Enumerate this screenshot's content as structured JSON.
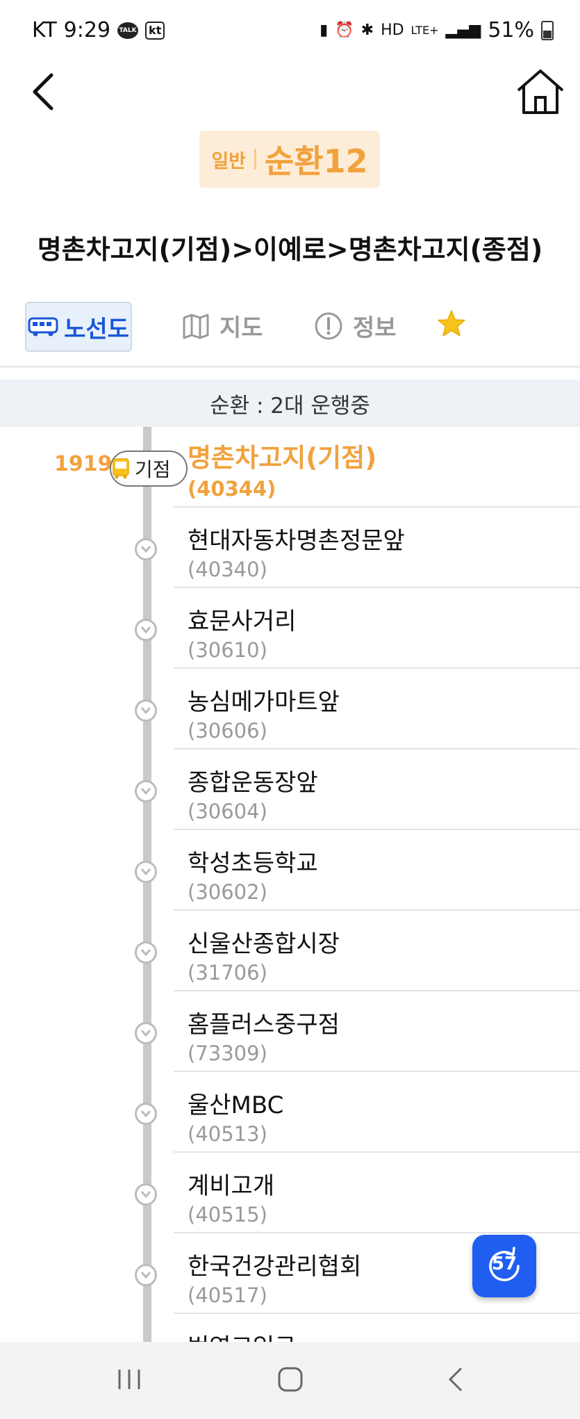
{
  "status_bar": {
    "carrier": "KT",
    "time": "9:29",
    "talk": "TALK",
    "kt": "kt",
    "network": "LTE+",
    "battery": "51%"
  },
  "route": {
    "type": "일반",
    "number": "순환12",
    "path": "명촌차고지(기점)>이예로>명촌차고지(종점)"
  },
  "tabs": [
    {
      "label": "노선도",
      "icon": "bus-icon"
    },
    {
      "label": "지도",
      "icon": "map-icon"
    },
    {
      "label": "정보",
      "icon": "info-icon"
    },
    {
      "label": "",
      "icon": "star-icon"
    }
  ],
  "operation_status": "순환 : 2대 운행중",
  "bus_position": {
    "vehicle": "1919",
    "label": "기점"
  },
  "stops": [
    {
      "name": "명촌차고지(기점)",
      "id": "(40344)"
    },
    {
      "name": "현대자동차명촌정문앞",
      "id": "(40340)"
    },
    {
      "name": "효문사거리",
      "id": "(30610)"
    },
    {
      "name": "농심메가마트앞",
      "id": "(30606)"
    },
    {
      "name": "종합운동장앞",
      "id": "(30604)"
    },
    {
      "name": "학성초등학교",
      "id": "(30602)"
    },
    {
      "name": "신울산종합시장",
      "id": "(31706)"
    },
    {
      "name": "홈플러스중구점",
      "id": "(73309)"
    },
    {
      "name": "울산MBC",
      "id": "(40513)"
    },
    {
      "name": "계비고개",
      "id": "(40515)"
    },
    {
      "name": "한국건강관리협회",
      "id": "(40517)"
    },
    {
      "name": "번영교입구",
      "id": ""
    }
  ],
  "refresh": {
    "seconds": "57"
  },
  "colors": {
    "accent_orange": "#f1a23d",
    "accent_blue": "#1f5ef0"
  }
}
